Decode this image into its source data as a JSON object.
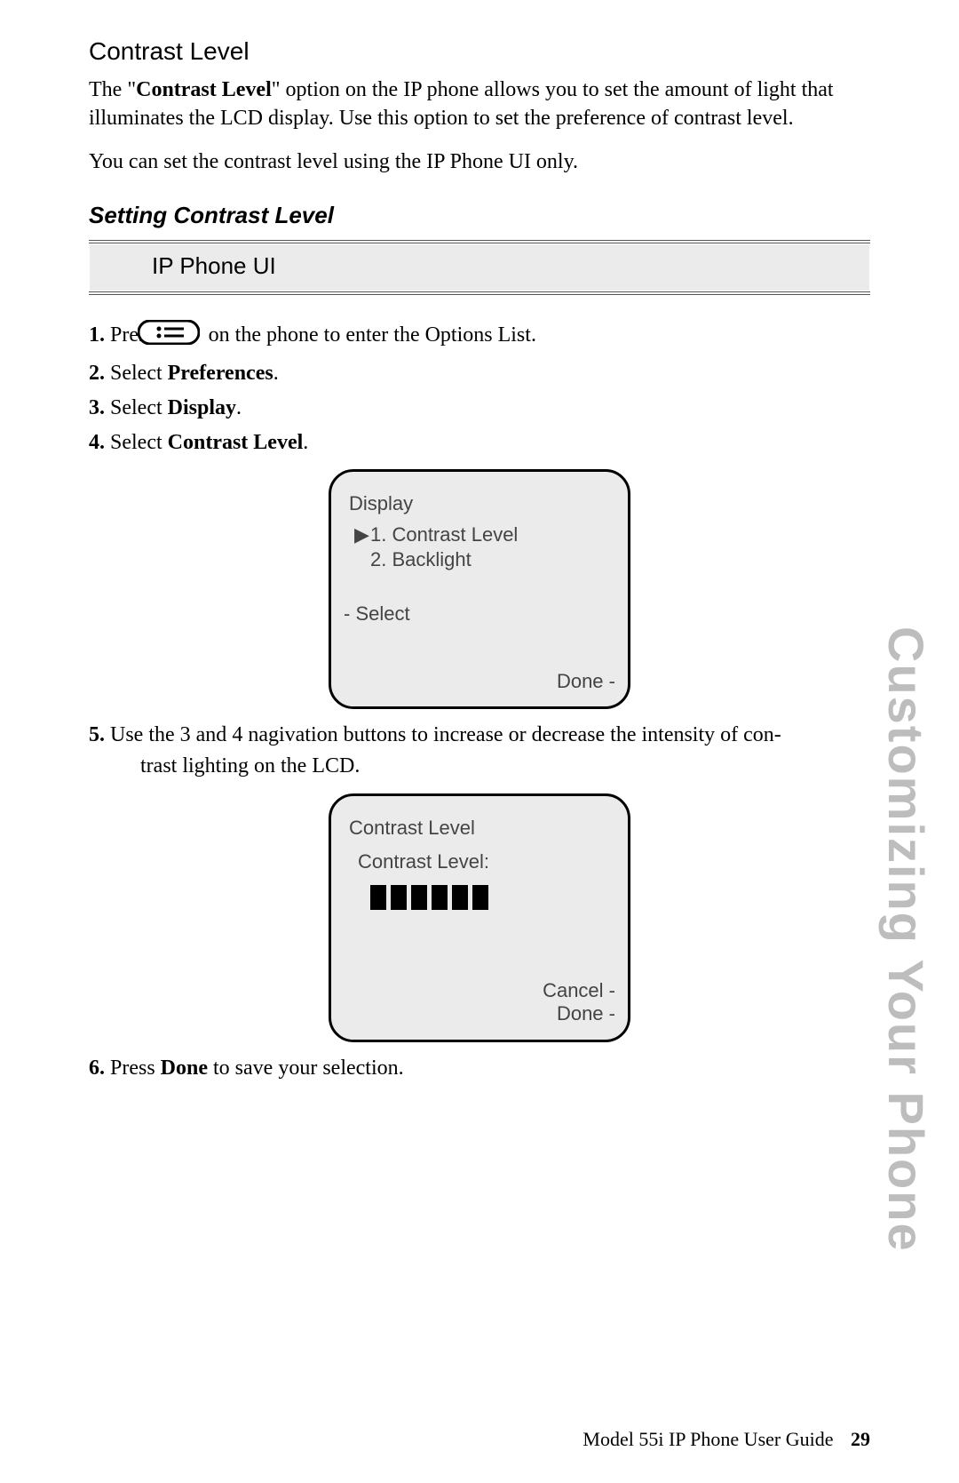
{
  "heading": "Contrast Level",
  "para1": "The \"Contrast Level\" option on the IP phone allows you to set the amount of light that illuminates the LCD display. Use this option to set the preference of contrast level.",
  "para1_bold": "Contrast Level",
  "para2": "You can set the contrast level using the IP Phone UI only.",
  "sub_heading": "Setting Contrast Level",
  "ui_bar": "IP Phone UI",
  "steps": {
    "s1": {
      "num": "1.",
      "pre": "Press",
      "post": "on the phone to enter the Options List."
    },
    "s2": {
      "num": "2.",
      "text": "Select",
      "bold": "Preferences",
      "after": "."
    },
    "s3": {
      "num": "3.",
      "text": "Select",
      "bold": "Display",
      "after": "."
    },
    "s4": {
      "num": "4.",
      "text": "Select",
      "bold": "Contrast Level",
      "after": "."
    },
    "s5": {
      "num": "5.",
      "text_a": "Use the ",
      "key1": "3",
      "mid": " and ",
      "key2": "4",
      "text_b": " nagivation buttons to increase or decrease the intensity of con-",
      "text_c": "trast lighting on the LCD."
    },
    "s6": {
      "num": "6.",
      "text": "Press",
      "bold": "Done",
      "after": " to save your selection."
    }
  },
  "screen1": {
    "title": "Display",
    "item1": "1. Contrast Level",
    "item2": "2. Backlight",
    "soft_left": "- Select",
    "soft_right": "Done -"
  },
  "screen2": {
    "title": "Contrast Level",
    "label": "Contrast Level:",
    "soft_upper": "Cancel -",
    "soft_right": "Done -"
  },
  "side_tab": "Customizing Your Phone",
  "footer": {
    "title": "Model 55i IP Phone User Guide",
    "page": "29"
  }
}
